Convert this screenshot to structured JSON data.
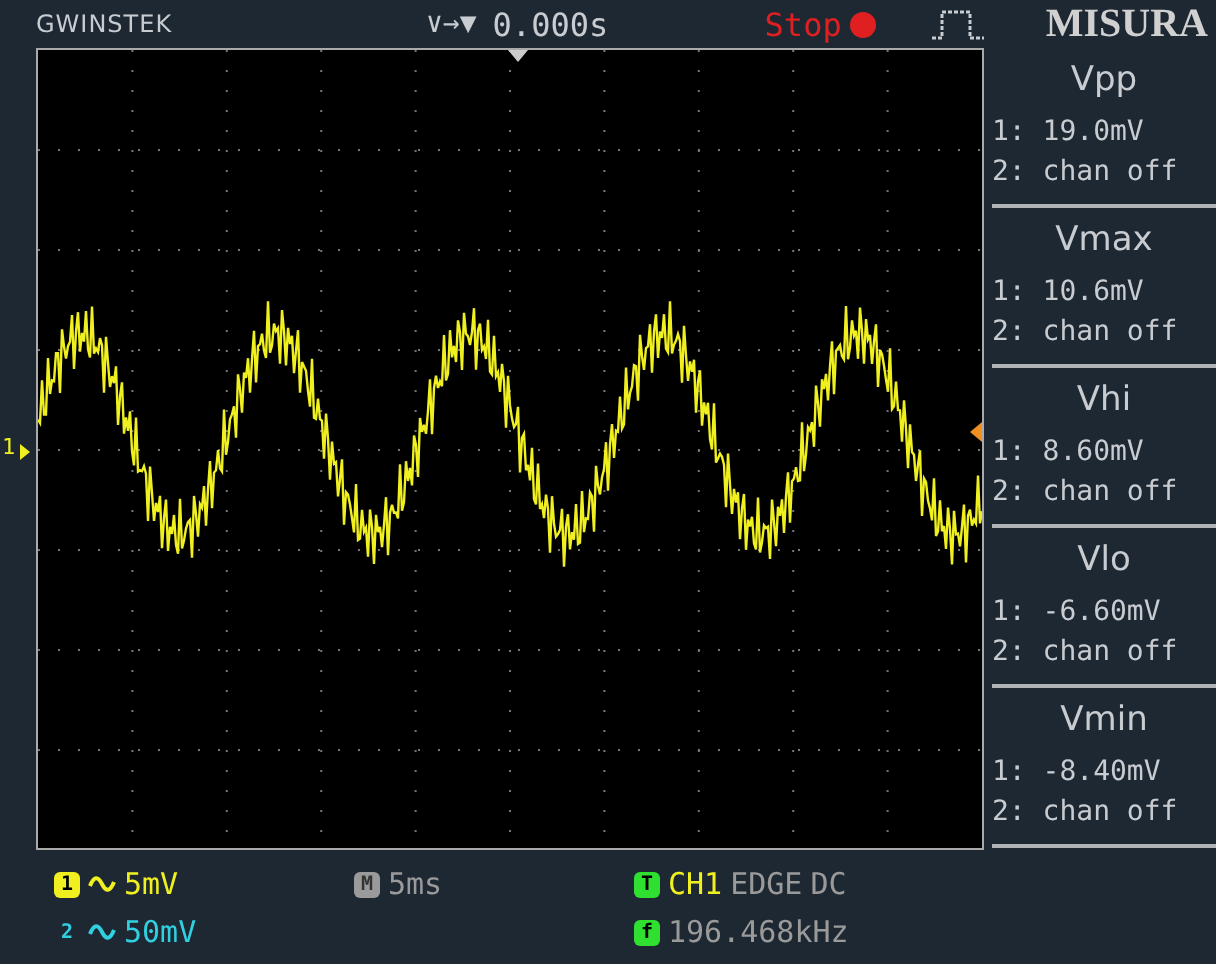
{
  "header": {
    "brand": "GWINSTEK",
    "trigger_icons": "∨→▼",
    "time_offset": "0.000s",
    "run_state": "Stop",
    "overlay_label": "MISURA"
  },
  "trace": {
    "channel_marker": "1"
  },
  "measurements": [
    {
      "name": "Vpp",
      "ch1": "1: 19.0mV",
      "ch2": "2: chan off"
    },
    {
      "name": "Vmax",
      "ch1": "1: 10.6mV",
      "ch2": "2: chan off"
    },
    {
      "name": "Vhi",
      "ch1": "1: 8.60mV",
      "ch2": "2: chan off"
    },
    {
      "name": "Vlo",
      "ch1": "1: -6.60mV",
      "ch2": "2: chan off"
    },
    {
      "name": "Vmin",
      "ch1": "1: -8.40mV",
      "ch2": "2: chan off"
    }
  ],
  "status": {
    "channels": [
      {
        "badge": "1",
        "scale": "5mV",
        "color": "#f0f020"
      },
      {
        "badge": "2",
        "scale": "50mV",
        "color": "#30d0e0"
      }
    ],
    "timebase_badge": "M",
    "timebase": "5ms",
    "trigger_badge": "T",
    "trigger_source": "CH1",
    "trigger_type": "EDGE",
    "trigger_coupling": "DC",
    "freq_badge": "f",
    "frequency": "196.468kHz"
  }
}
